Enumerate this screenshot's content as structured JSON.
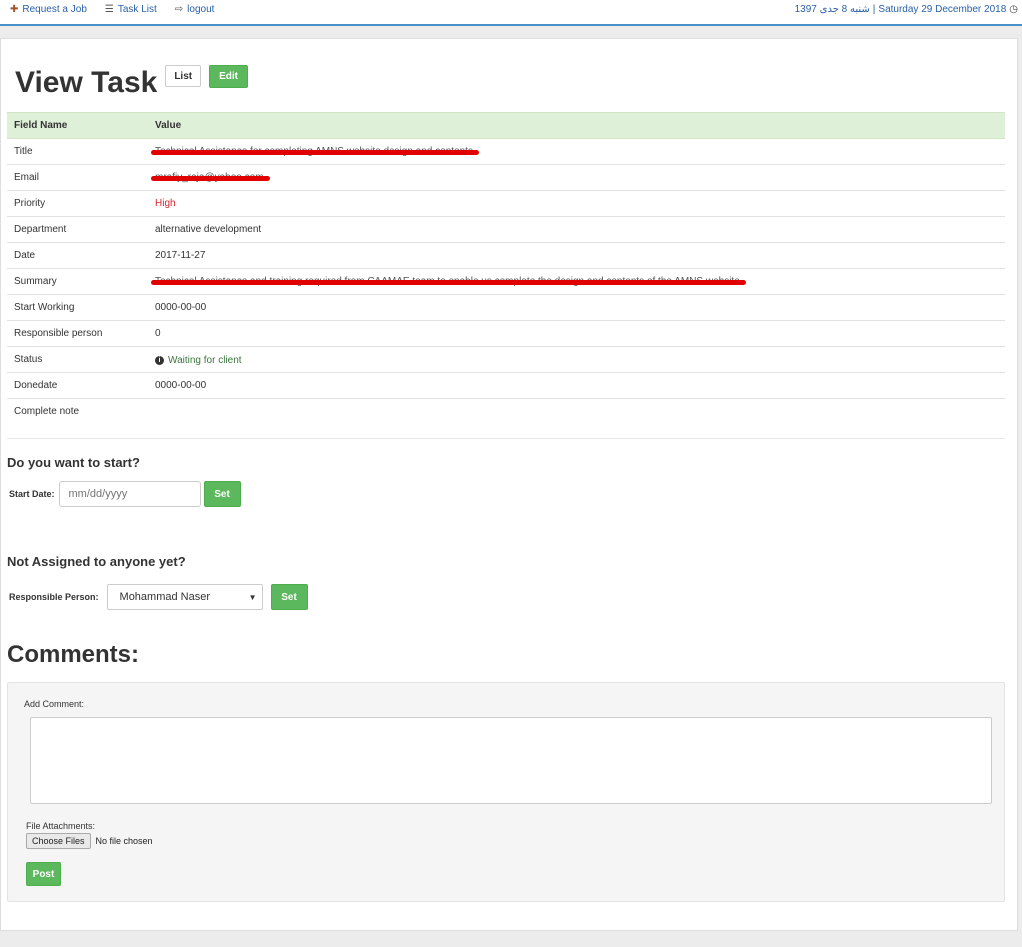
{
  "nav": {
    "items": [
      {
        "label": "Request a Job",
        "icon": "plus-icon"
      },
      {
        "label": "Task List",
        "icon": "list-icon"
      },
      {
        "label": "logout",
        "icon": "logout-icon"
      }
    ],
    "date_persian": "1397 شنبه 8 جدی",
    "date_separator": "|",
    "date_english": "Saturday 29 December 2018"
  },
  "page": {
    "title": "View Task",
    "list_label": "List",
    "edit_label": "Edit"
  },
  "table": {
    "headers": {
      "field": "Field Name",
      "value": "Value"
    },
    "rows": {
      "title": {
        "label": "Title",
        "value": "Technical Assistance for completing AMNS website design and contents"
      },
      "email": {
        "label": "Email",
        "value": "mrafiy_raja@yahoo.com"
      },
      "priority": {
        "label": "Priority",
        "value": "High"
      },
      "department": {
        "label": "Department",
        "value": "alternative development"
      },
      "date": {
        "label": "Date",
        "value": "2017-11-27"
      },
      "summary": {
        "label": "Summary",
        "value": "Technical Assistance and training required from CAAMAE team to enable us complete the design and contents of the AMNS website"
      },
      "start_working": {
        "label": "Start Working",
        "value": "0000-00-00"
      },
      "responsible": {
        "label": "Responsible person",
        "value": "0"
      },
      "status": {
        "label": "Status",
        "value": "Waiting for client"
      },
      "donedate": {
        "label": "Donedate",
        "value": "0000-00-00"
      },
      "complete_note": {
        "label": "Complete note",
        "value": ""
      }
    }
  },
  "start_section": {
    "heading": "Do you want to start?",
    "label": "Start Date:",
    "placeholder": "mm/dd/yyyy",
    "button": "Set"
  },
  "assign_section": {
    "heading": "Not Assigned to anyone yet?",
    "label": "Responsible Person:",
    "selected": "Mohammad Naser",
    "button": "Set"
  },
  "comments": {
    "heading": "Comments:",
    "add_label": "Add Comment:",
    "file_label": "File Attachments:",
    "choose_label": "Choose Files",
    "no_file": "No file chosen",
    "post_label": "Post"
  },
  "colors": {
    "accent_green": "#5cb85c",
    "header_green": "#dff0d8",
    "priority_red": "#d9232d",
    "link_blue": "#2a5fa8"
  }
}
